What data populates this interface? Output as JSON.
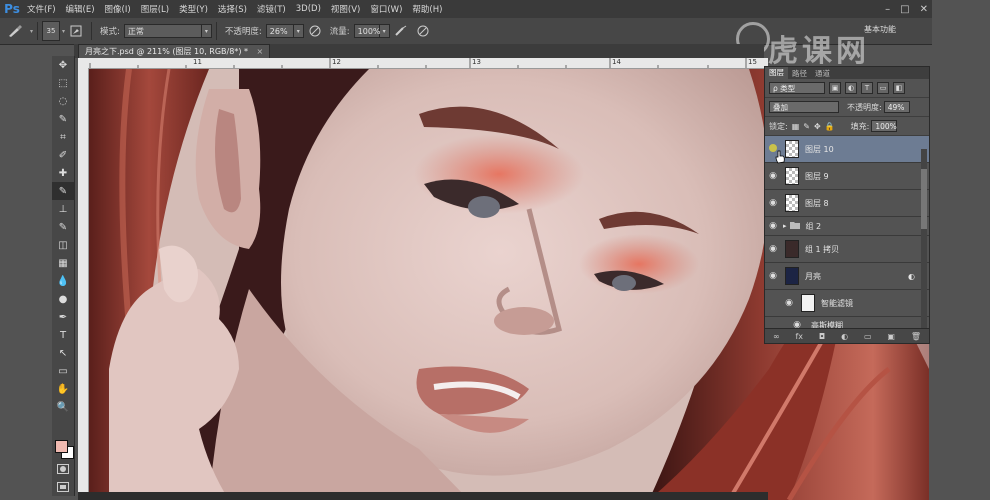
{
  "app": {
    "logo": "Ps"
  },
  "menu": [
    "文件(F)",
    "编辑(E)",
    "图像(I)",
    "图层(L)",
    "类型(Y)",
    "选择(S)",
    "滤镜(T)",
    "3D(D)",
    "视图(V)",
    "窗口(W)",
    "帮助(H)"
  ],
  "window_controls": [
    "–",
    "□",
    "✕"
  ],
  "options": {
    "brush_size": "35",
    "mode_label": "模式:",
    "mode_value": "正常",
    "opacity_label": "不透明度:",
    "opacity_value": "26%",
    "flow_label": "流量:",
    "flow_value": "100%",
    "workspace": "基本功能"
  },
  "watermark": "虎课网",
  "document": {
    "tab_title": "月亮之下.psd @ 211% (图层 10, RGB/8*) *",
    "close": "×"
  },
  "ruler_numbers": [
    "11",
    "12",
    "13",
    "14",
    "15"
  ],
  "tools": [
    "move-tool-icon",
    "marquee-icon",
    "lasso-icon",
    "quick-select-icon",
    "crop-icon",
    "eyedropper-icon",
    "healing-icon",
    "brush-icon",
    "stamp-icon",
    "history-brush-icon",
    "eraser-icon",
    "gradient-icon",
    "blur-icon",
    "dodge-icon",
    "pen-icon",
    "type-icon",
    "path-select-icon",
    "shape-icon",
    "hand-icon",
    "zoom-icon"
  ],
  "tool_glyphs": [
    "✥",
    "⬚",
    "◌",
    "✎",
    "⌗",
    "✐",
    "✚",
    "✎",
    "⊥",
    "✎",
    "◫",
    "▦",
    "💧",
    "●",
    "✒",
    "T",
    "↖",
    "▭",
    "✋",
    "🔍"
  ],
  "layers_panel": {
    "tabs": [
      "图层",
      "路径",
      "通道"
    ],
    "filter_label": "ρ 类型",
    "filter_icons": [
      "▣",
      "◐",
      "T",
      "▭",
      "◧"
    ],
    "blend_mode": "叠加",
    "opacity_label": "不透明度:",
    "opacity_value": "49%",
    "lock_label": "锁定:",
    "lock_icons": [
      "▦",
      "✎",
      "✥",
      "🔒"
    ],
    "fill_label": "填充:",
    "fill_value": "100%",
    "layers": [
      {
        "name": "图层 10",
        "active": true
      },
      {
        "name": "图层 9",
        "active": false
      },
      {
        "name": "图层 8",
        "active": false
      },
      {
        "name": "组 2",
        "active": false
      },
      {
        "name": "组 1 拷贝",
        "active": false
      },
      {
        "name": "月亮",
        "active": false
      },
      {
        "name": "智能滤镜",
        "active": false
      },
      {
        "name": "高斯模糊",
        "active": false
      }
    ],
    "bottom_icons": [
      "∞",
      "fx",
      "◘",
      "◐",
      "▭",
      "▣",
      "🗑"
    ]
  },
  "colors": {
    "foreground": "#f0b9b0",
    "background": "#ffffff",
    "active_layer": "#6d7c93"
  }
}
